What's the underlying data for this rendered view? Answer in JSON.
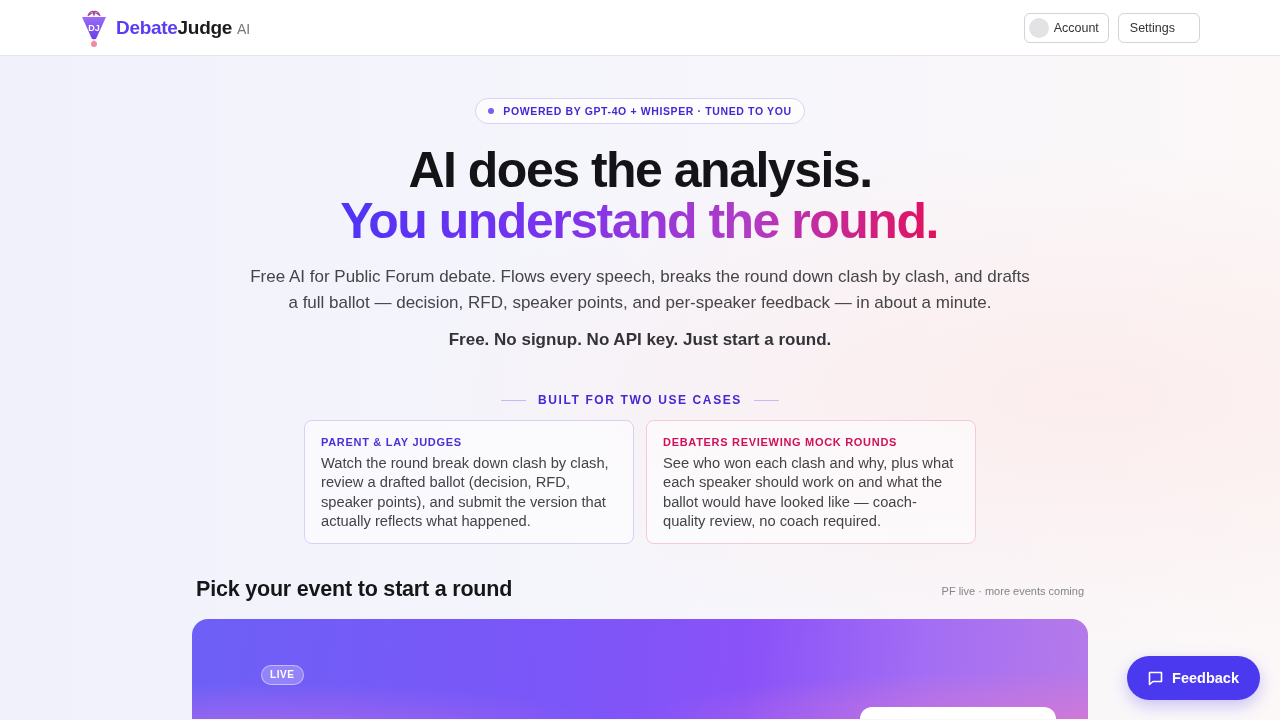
{
  "header": {
    "logo_mark": "DJ",
    "brand_first": "Debate",
    "brand_second": "Judge",
    "brand_suffix": "AI",
    "buttons": [
      {
        "kind": "account",
        "label": "Account"
      },
      {
        "kind": "plain",
        "label": "Settings"
      }
    ]
  },
  "hero": {
    "badge": "POWERED BY GPT-4O + WHISPER · TUNED TO YOU",
    "title_line_1": "AI does the analysis.",
    "title_line_2": "You understand the round.",
    "description": "Free AI for Public Forum debate. Flows every speech, breaks the round down clash by clash, and drafts a full ballot — decision, RFD, speaker points, and per-speaker feedback — in about a minute.",
    "tagline": "Free. No signup. No API key. Just start a round."
  },
  "use_cases": {
    "heading": "BUILT FOR TWO USE CASES",
    "cards": [
      {
        "title": "PARENT & LAY JUDGES",
        "text": "Watch the round break down clash by clash, review a drafted ballot (decision, RFD, speaker points), and submit the version that actually reflects what happened.",
        "color": "#4b2fd6"
      },
      {
        "title": "DEBATERS REVIEWING MOCK ROUNDS",
        "text": "See who won each clash and why, plus what each speaker should work on and what the ballot would have looked like — coach-quality review, no coach required.",
        "color": "#d0105a"
      }
    ]
  },
  "events": {
    "heading": "Pick your event to start a round",
    "note": "PF live · more events coming",
    "cards": [
      {
        "badge": "LIVE"
      }
    ]
  },
  "feedback_button": {
    "label": "Feedback"
  }
}
